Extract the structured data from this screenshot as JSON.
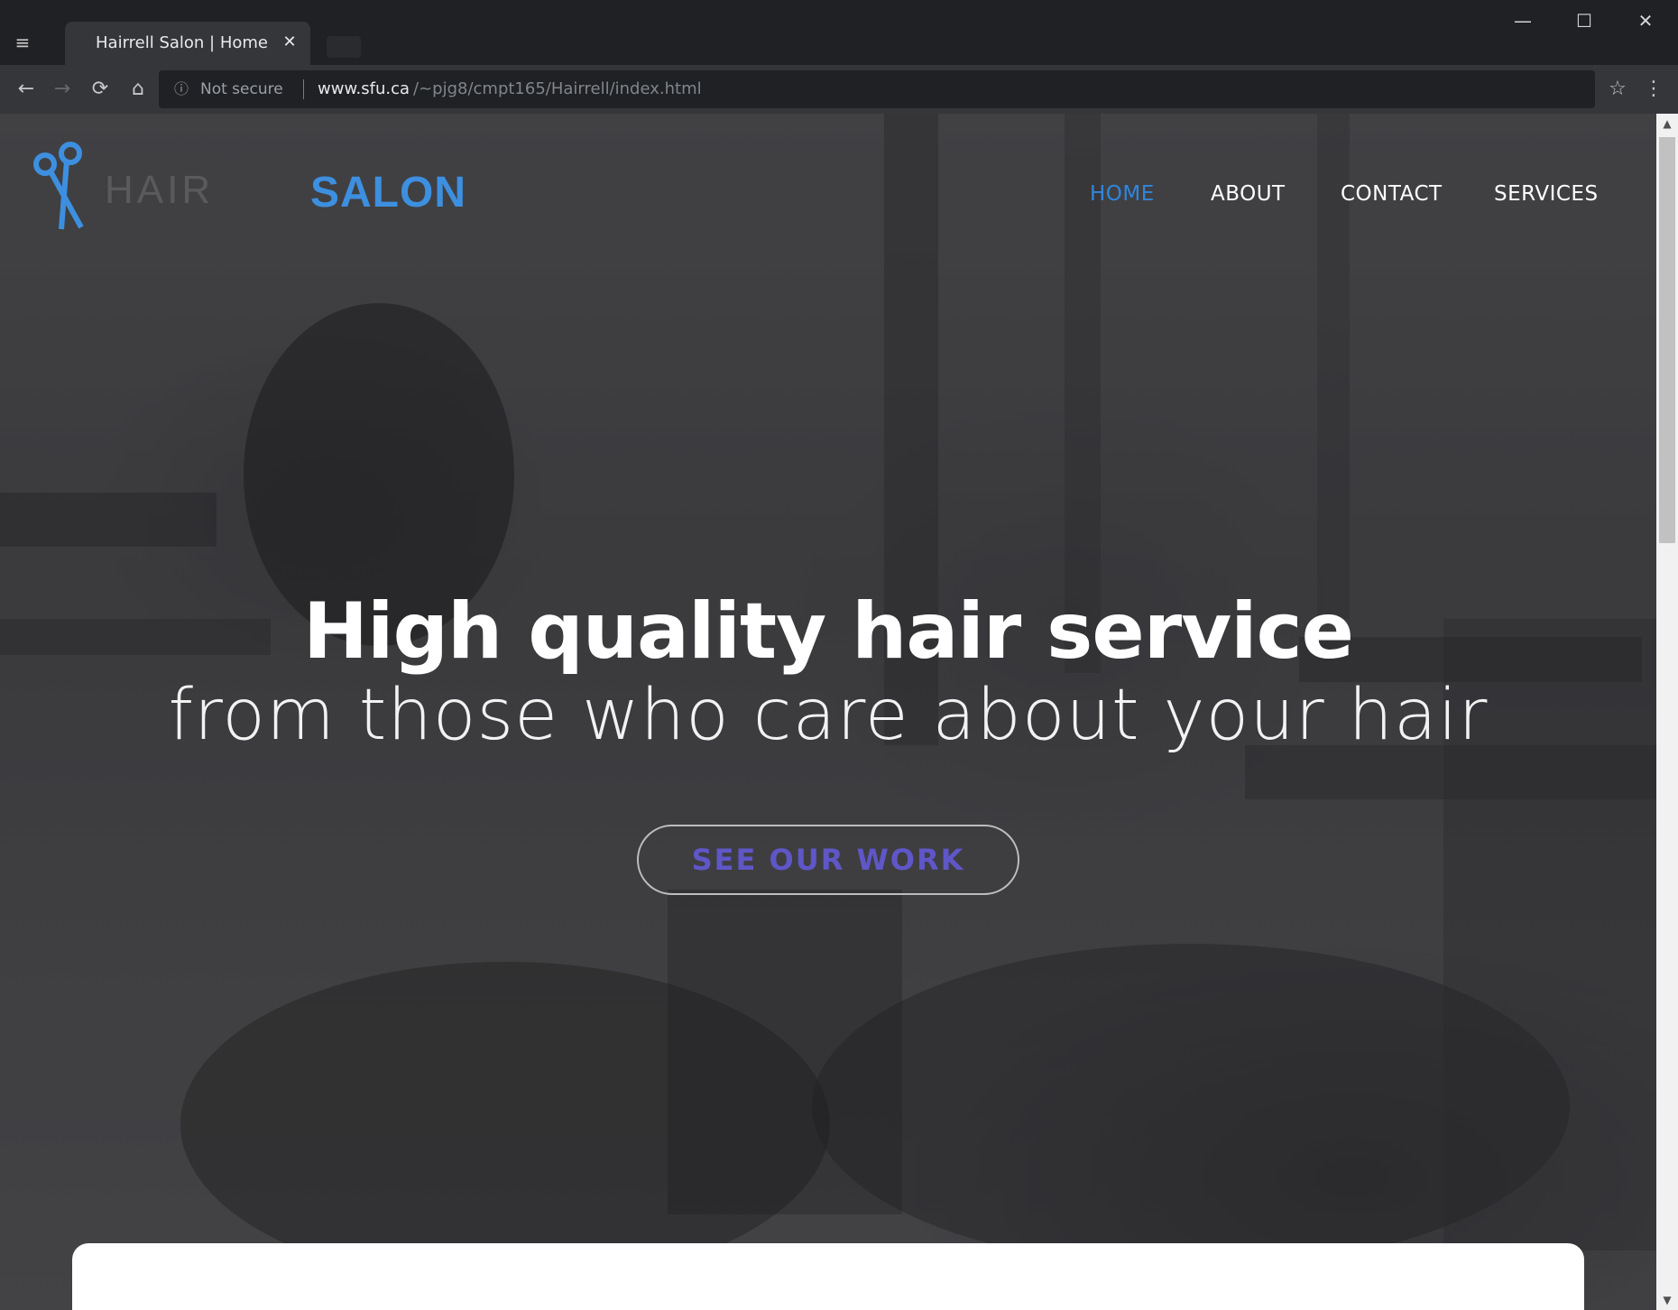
{
  "browser": {
    "tab_title": "Hairrell Salon | Home",
    "tab_close_glyph": "✕",
    "menu_glyph": "≡",
    "secure_label": "Not secure",
    "secure_icon": "info-icon",
    "url_host": "www.sfu.ca",
    "url_path": "/~pjg8/cmpt165/Hairrell/index.html",
    "window_buttons": {
      "minimize": "—",
      "maximize": "☐",
      "close": "✕"
    },
    "nav_glyphs": {
      "back": "←",
      "forward": "→",
      "reload": "⟳",
      "home": "⌂",
      "star": "☆",
      "more": "⋮"
    }
  },
  "site": {
    "logo_word": "HAIR",
    "logo_salon": "SALON",
    "nav": [
      {
        "label": "HOME",
        "active": true
      },
      {
        "label": "ABOUT",
        "active": false
      },
      {
        "label": "CONTACT",
        "active": false
      },
      {
        "label": "SERVICES",
        "active": false
      }
    ],
    "hero_title": "High quality hair service",
    "hero_subtitle": "from those who care about your hair",
    "cta_label": "SEE OUR WORK",
    "colors": {
      "accent": "#2f86dd",
      "cta_text": "#5f56c8",
      "hero_bg": "#454547"
    }
  }
}
